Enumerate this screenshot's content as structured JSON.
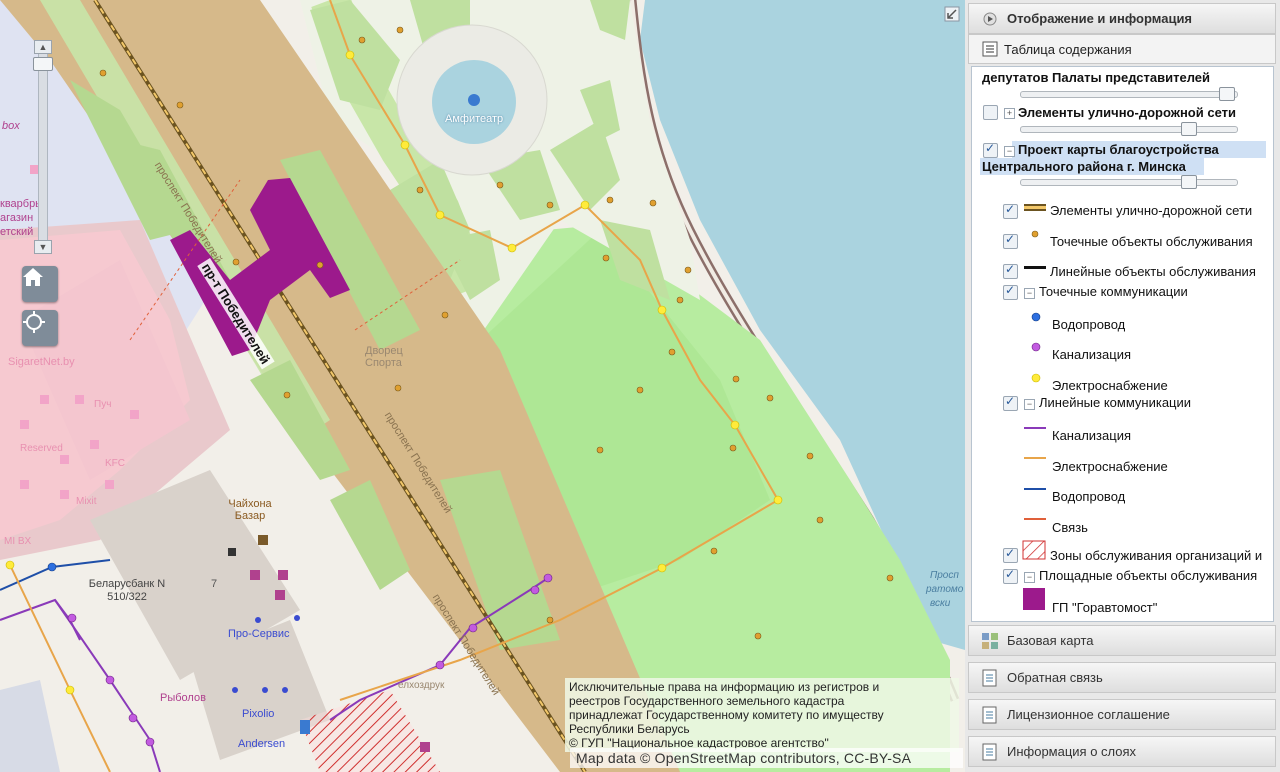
{
  "map": {
    "labels": {
      "amphitheatre": "Амфитеатр",
      "avenue_label": "пр-т Победителей",
      "prospekt_1": "проспект Победителей",
      "prospekt_2": "проспект Победителей",
      "prospekt_3": "проспект Победителей",
      "palace": "Дворец Спорта",
      "chaihona": "Чайхона Базар",
      "belarusbank": "Беларусбанк N 510/322",
      "house_7": "7",
      "proservis": "Про-Сервис",
      "rybolov": "Рыболов",
      "pixolio": "Pixolio",
      "andersen": "Andersen",
      "sigaretnet": "SigaretNet.by",
      "kvarbox": "box",
      "kvartiry": "кварбры",
      "magazin": "агазин",
      "sovetsky": "етский",
      "puch": "Пуч",
      "reserved": "Reserved",
      "kfc": "KFC",
      "mixit": "Mixit",
      "mi_bx": "MI BX",
      "prosp_side": "Просп",
      "ratomo": "ратомо",
      "vski": "вски",
      "zdruk": "елхоздрук"
    },
    "attribution": [
      "Исключительные права на информацию из регистров и",
      "реестров Государственного земельного кадастра",
      "принадлежат Государственному комитету по имуществу",
      "Республики Беларусь",
      "© ГУП \"Национальное кадастровое агентство\""
    ],
    "osm_credit": "Map data © OpenStreetMap contributors, CC-BY-SA"
  },
  "panel": {
    "header": "Отображение и информация",
    "toc_title": "Таблица содержания",
    "layers": {
      "deputies": "депутатов Палаты представителей",
      "street_network": "Элементы улично-дорожной сети",
      "project_line1": "Проект карты благоустройства",
      "project_line2": "Центрального района г. Минска"
    },
    "legend": {
      "street_elements": "Элементы улично-дорожной сети",
      "point_service": "Точечные объекты обслуживания",
      "linear_service": "Линейные объекты обслуживания",
      "point_comm": "Точечные коммуникации",
      "water_pt": "Водопровод",
      "sewer_pt": "Канализация",
      "power_pt": "Электроснабжение",
      "linear_comm": "Линейные коммуникации",
      "sewer_ln": "Канализация",
      "power_ln": "Электроснабжение",
      "water_ln": "Водопровод",
      "comm_ln": "Связь",
      "service_zones": "Зоны обслуживания организаций и",
      "area_service": "Площадные объекты обслуживания",
      "goravtomost": "ГП \"Горавтомост\""
    },
    "bottom_sections": [
      "Базовая карта",
      "Обратная связь",
      "Лицензионное соглашение",
      "Информация о слоях"
    ]
  },
  "colors": {
    "road": "#d6b98a",
    "water": "#aad3df",
    "green_zone": "#b7eca0",
    "park": "#c8e6a8",
    "purple": "#9c1a8c",
    "sewer": "#8a3ab9",
    "power": "#e8a54a",
    "water_line": "#1f4fa8",
    "comm": "#e0603a"
  },
  "zoom": {
    "level_fraction": 0.94
  }
}
